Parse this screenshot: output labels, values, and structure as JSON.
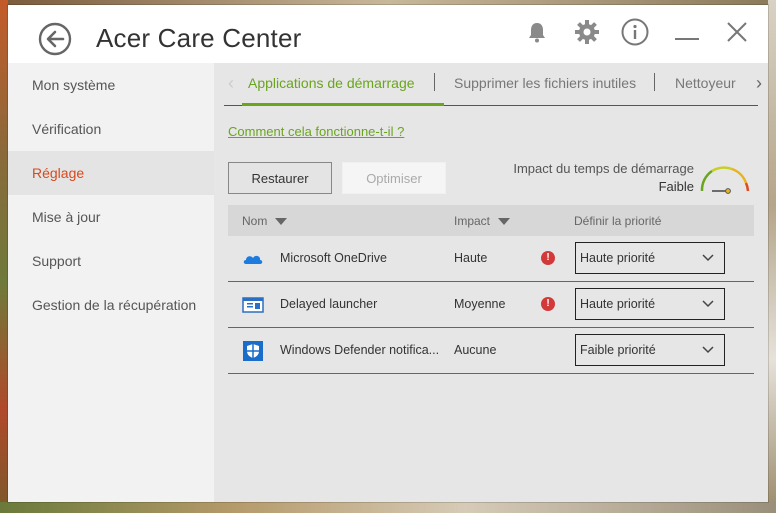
{
  "window": {
    "title": "Acer Care Center"
  },
  "sidebar": {
    "items": [
      {
        "label": "Mon système"
      },
      {
        "label": "Vérification"
      },
      {
        "label": "Réglage",
        "active": true
      },
      {
        "label": "Mise à jour"
      },
      {
        "label": "Support"
      },
      {
        "label": "Gestion de la récupération"
      }
    ]
  },
  "tabs": [
    {
      "label": "Applications de démarrage",
      "active": true
    },
    {
      "label": "Supprimer les fichiers inutiles"
    },
    {
      "label": "Nettoyeur"
    }
  ],
  "help_link": "Comment cela fonctionne-t-il ?",
  "buttons": {
    "restore": "Restaurer",
    "optimize": "Optimiser"
  },
  "impact_summary": {
    "label": "Impact du temps de démarrage",
    "value": "Faible"
  },
  "table": {
    "headers": {
      "name": "Nom",
      "impact": "Impact",
      "priority": "Définir la priorité"
    },
    "rows": [
      {
        "icon": "onedrive-icon",
        "name": "Microsoft OneDrive",
        "impact": "Haute",
        "warning": true,
        "priority": "Haute priorité"
      },
      {
        "icon": "launcher-icon",
        "name": "Delayed launcher",
        "impact": "Moyenne",
        "warning": true,
        "priority": "Haute priorité"
      },
      {
        "icon": "defender-icon",
        "name": "Windows Defender notifica...",
        "impact": "Aucune",
        "warning": false,
        "priority": "Faible priorité"
      }
    ]
  },
  "colors": {
    "accent": "#6aa51e",
    "active_sidebar": "#d64a1e",
    "warning": "#d23a3a"
  }
}
